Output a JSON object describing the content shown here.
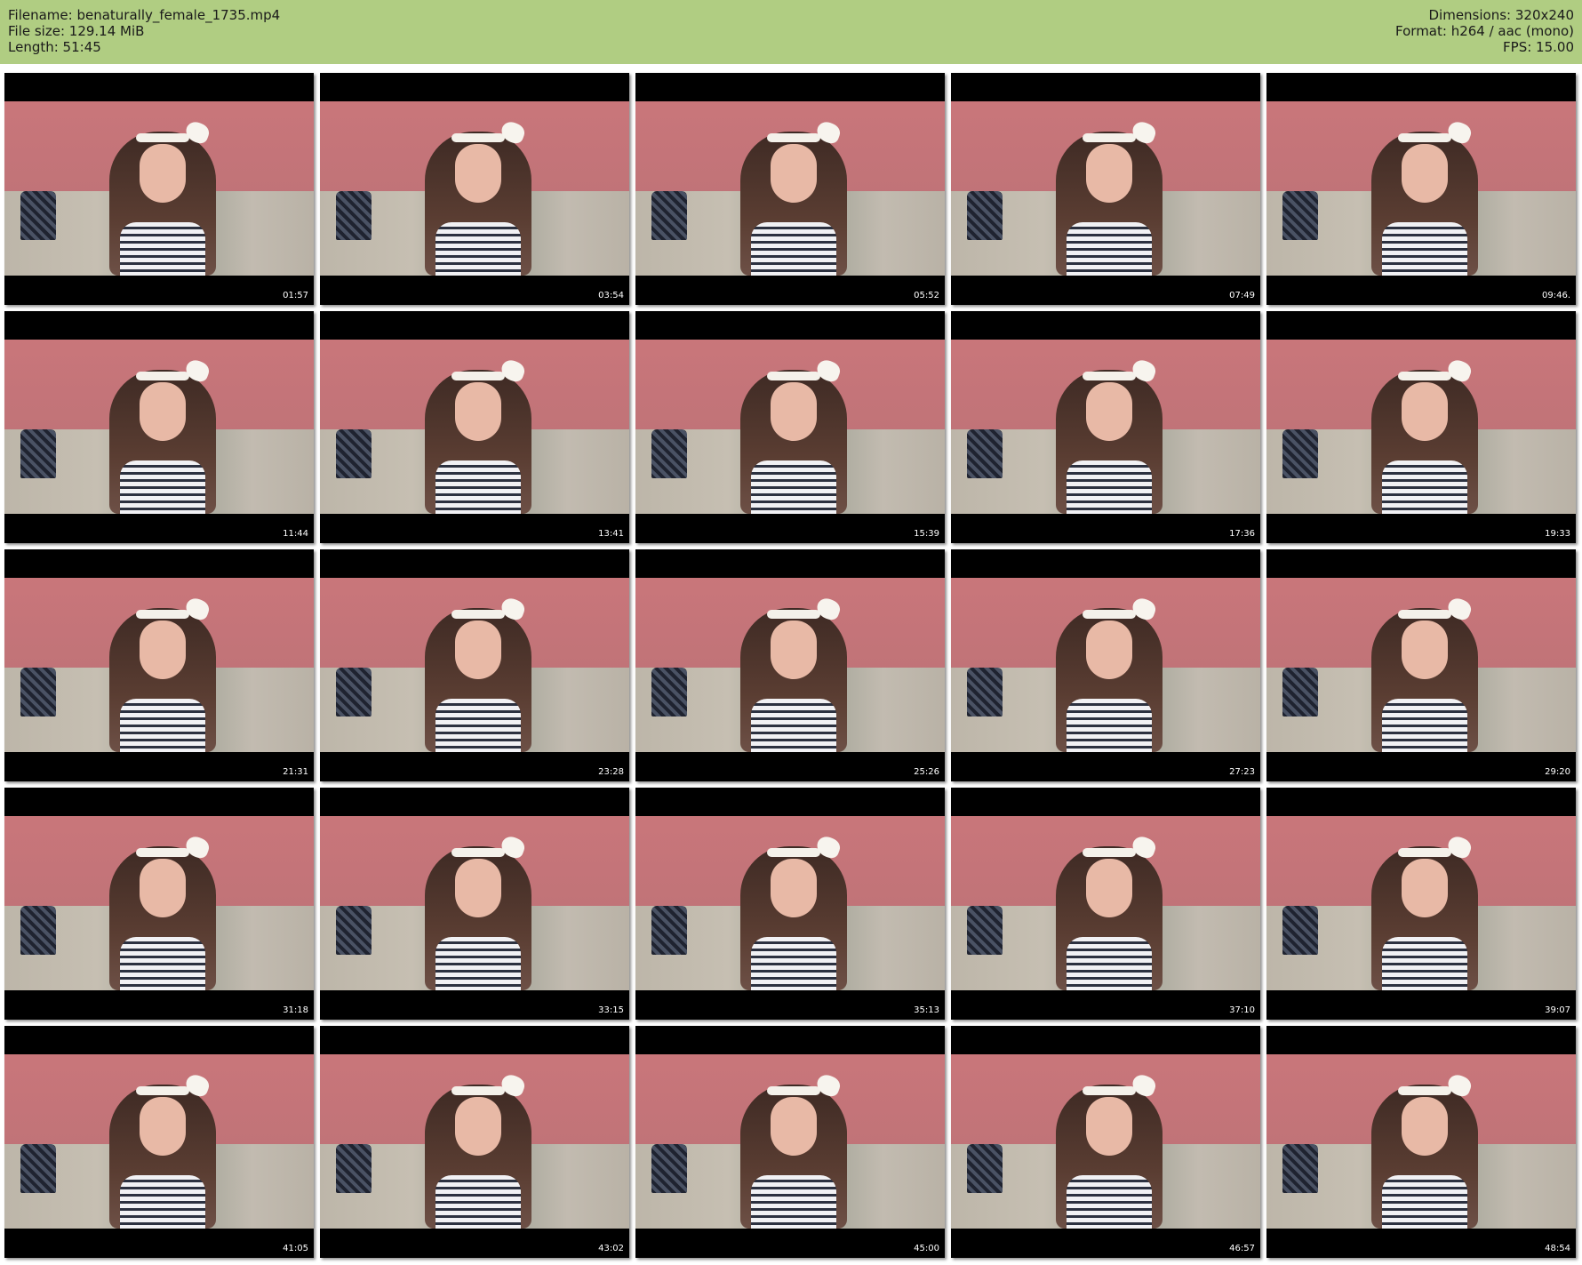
{
  "header": {
    "filename_line": "Filename: benaturally_female_1735.mp4",
    "filesize_line": "File size: 129.14 MiB",
    "length_line": "Length: 51:45",
    "dimensions_line": "Dimensions: 320x240",
    "format_line": "Format: h264 / aac (mono)",
    "fps_line": "FPS: 15.00"
  },
  "colors": {
    "header_background": "#b0cd82",
    "thumbnail_frame": "#000000",
    "wall": "#c9767a"
  },
  "thumbnails": [
    {
      "time": "01:57"
    },
    {
      "time": "03:54"
    },
    {
      "time": "05:52"
    },
    {
      "time": "07:49"
    },
    {
      "time": "09:46."
    },
    {
      "time": "11:44"
    },
    {
      "time": "13:41"
    },
    {
      "time": "15:39"
    },
    {
      "time": "17:36"
    },
    {
      "time": "19:33"
    },
    {
      "time": "21:31"
    },
    {
      "time": "23:28"
    },
    {
      "time": "25:26"
    },
    {
      "time": "27:23"
    },
    {
      "time": "29:20"
    },
    {
      "time": "31:18"
    },
    {
      "time": "33:15"
    },
    {
      "time": "35:13"
    },
    {
      "time": "37:10"
    },
    {
      "time": "39:07"
    },
    {
      "time": "41:05"
    },
    {
      "time": "43:02"
    },
    {
      "time": "45:00"
    },
    {
      "time": "46:57"
    },
    {
      "time": "48:54"
    }
  ]
}
